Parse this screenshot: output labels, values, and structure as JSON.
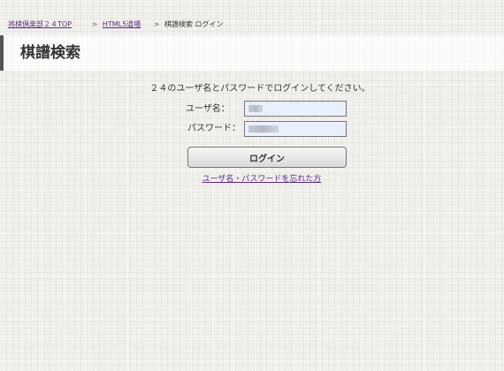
{
  "breadcrumb": {
    "home": "将棋倶楽部２４TOP",
    "sep1": ">",
    "section": "HTML5道場",
    "sep2": ">",
    "current": "棋譜検索 ログイン"
  },
  "page": {
    "title": "棋譜検索"
  },
  "login_form": {
    "instruction": "２４のユーザ名とパスワードでログインしてください。",
    "username_label": "ユーザ名：",
    "password_label": "パスワード：",
    "login_button": "ログイン",
    "forgot_link": "ユーザ名・パスワードを忘れた方"
  }
}
